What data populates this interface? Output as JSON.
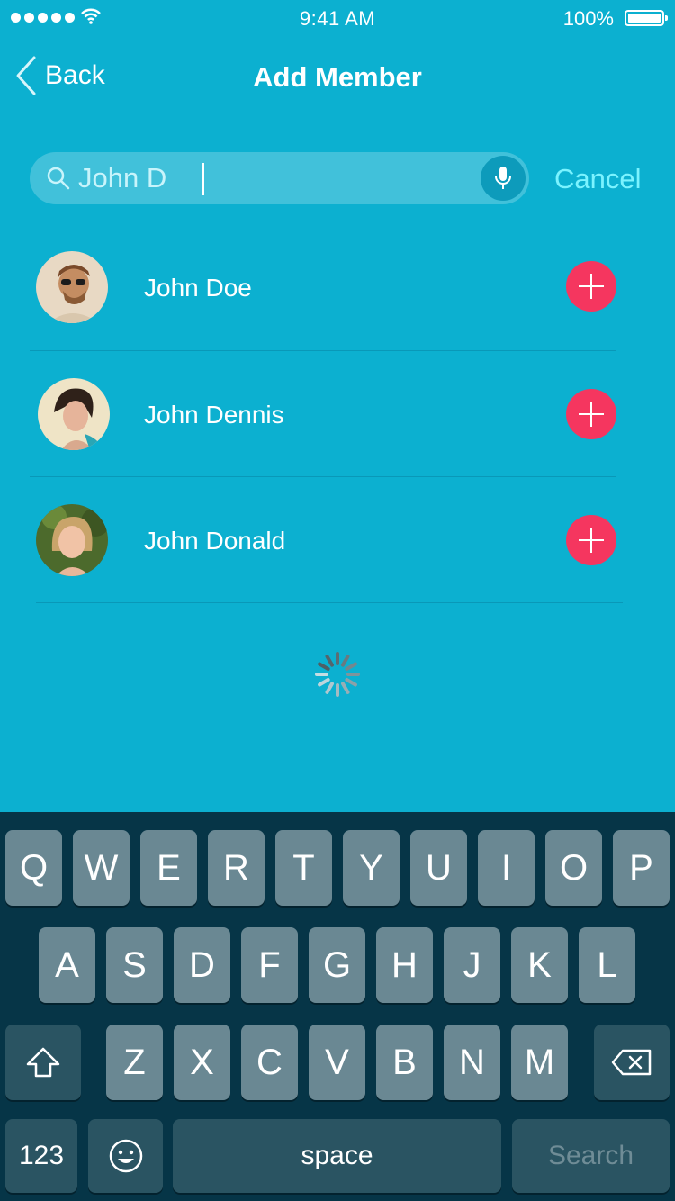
{
  "status_bar": {
    "time": "9:41 AM",
    "battery": "100%"
  },
  "nav": {
    "back_label": "Back",
    "title": "Add Member"
  },
  "search": {
    "value": "John D",
    "cancel_label": "Cancel"
  },
  "members": [
    {
      "name": "John Doe"
    },
    {
      "name": "John Dennis"
    },
    {
      "name": "John Donald"
    }
  ],
  "keyboard": {
    "row1": [
      "Q",
      "W",
      "E",
      "R",
      "T",
      "Y",
      "U",
      "I",
      "O",
      "P"
    ],
    "row2": [
      "A",
      "S",
      "D",
      "F",
      "G",
      "H",
      "J",
      "K",
      "L"
    ],
    "row3": [
      "Z",
      "X",
      "C",
      "V",
      "B",
      "N",
      "M"
    ],
    "numbers_label": "123",
    "space_label": "space",
    "search_label": "Search"
  },
  "colors": {
    "background": "#0cb0d0",
    "accent": "#7bf3ff",
    "add_button": "#f5365f",
    "keyboard": "#063547"
  },
  "icons": [
    "back-chevron-icon",
    "search-icon",
    "microphone-icon",
    "plus-icon",
    "shift-icon",
    "delete-icon",
    "emoji-icon",
    "loading-spinner-icon"
  ]
}
